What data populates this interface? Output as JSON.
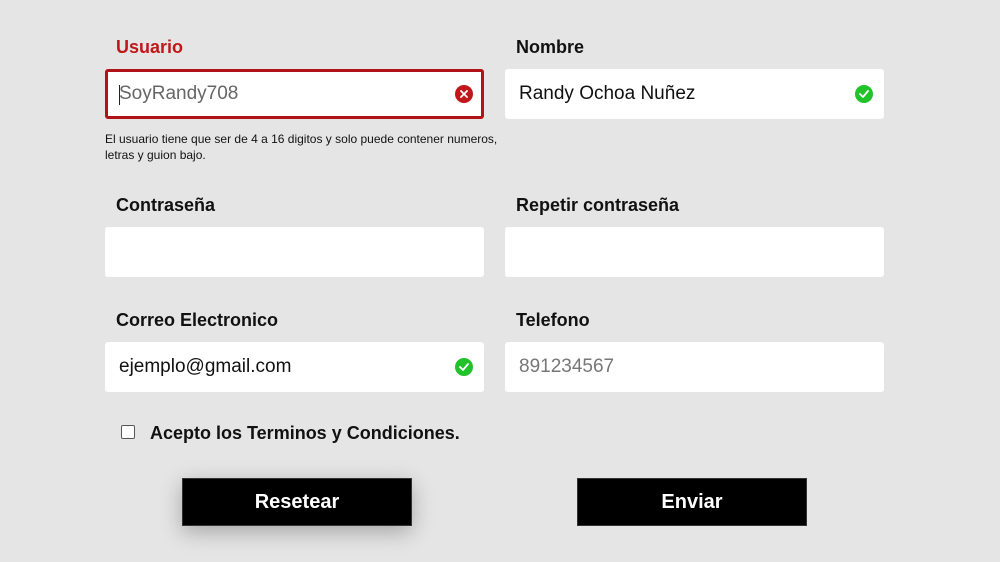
{
  "form": {
    "usuario": {
      "label": "Usuario",
      "value": "SoyRandy708",
      "status": "error",
      "helper": "El usuario tiene que ser de 4 a 16 digitos y solo puede contener numeros, letras y guion bajo."
    },
    "nombre": {
      "label": "Nombre",
      "value": "Randy Ochoa Nuñez",
      "status": "valid"
    },
    "contrasena": {
      "label": "Contraseña",
      "value": ""
    },
    "repetir_contrasena": {
      "label": "Repetir contraseña",
      "value": ""
    },
    "correo": {
      "label": "Correo Electronico",
      "value": "ejemplo@gmail.com",
      "status": "valid"
    },
    "telefono": {
      "label": "Telefono",
      "placeholder": "891234567"
    },
    "terms": {
      "label": "Acepto los Terminos y Condiciones.",
      "checked": false
    },
    "buttons": {
      "reset_label": "Resetear",
      "submit_label": "Enviar"
    }
  },
  "colors": {
    "error": "#c0171b",
    "valid": "#22c22a",
    "background": "#e5e5e5",
    "button": "#000000"
  },
  "icons": {
    "error": "x-circle-icon",
    "valid": "check-circle-icon"
  }
}
